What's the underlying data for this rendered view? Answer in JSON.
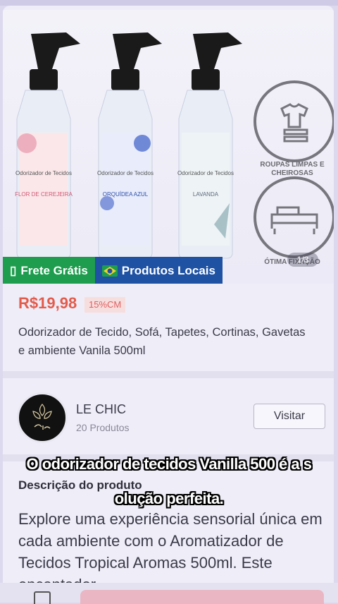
{
  "badges": {
    "free_shipping": "Frete Grátis",
    "local_products": "Produtos Locais"
  },
  "gallery": {
    "counter": "1/3"
  },
  "features": {
    "clothes": "ROUPAS LIMPAS E CHEIROSAS",
    "fixation": "ÓTIMA FIXAÇÃO"
  },
  "bottles": [
    {
      "label": "Odorizador de Tecidos",
      "scent": "FLOR DE CEREJEIRA",
      "accent": "#e58aa0"
    },
    {
      "label": "Odorizador de Tecidos",
      "scent": "ORQUÍDEA AZUL",
      "accent": "#3d5fc8"
    },
    {
      "label": "Odorizador de Tecidos",
      "scent": "LAVANDA",
      "accent": "#8fa0b8"
    }
  ],
  "product": {
    "price": "R$19,98",
    "discount": "15%CM",
    "title": "Odorizador de Tecido, Sofá, Tapetes, Cortinas, Gavetas e ambiente Vanila 500ml"
  },
  "store": {
    "name": "LE CHIC",
    "count": "20 Produtos",
    "visit": "Visitar"
  },
  "description": {
    "heading": "Descrição do produto",
    "body": "Explore uma experiência sensorial única em cada ambiente com o Aromatizador de Tecidos Tropical Aromas 500ml. Este encantador"
  },
  "caption": {
    "line1": "O odorizador de tecidos Vanilla 500 é a s",
    "line2": "olução perfeita."
  }
}
